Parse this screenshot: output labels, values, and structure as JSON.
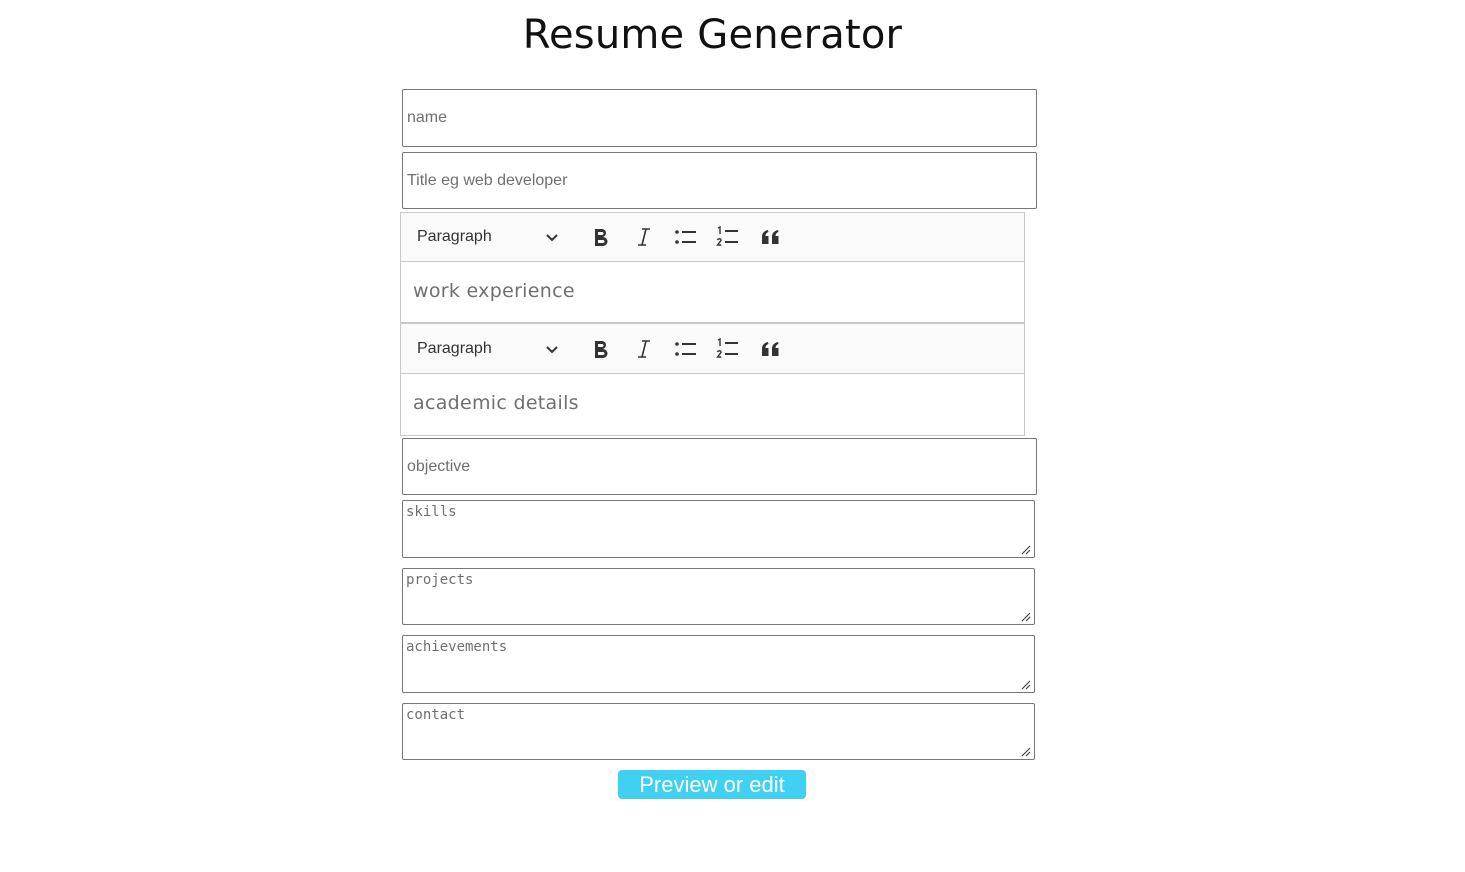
{
  "page": {
    "title": "Resume Generator"
  },
  "form": {
    "name_placeholder": "name",
    "title_placeholder": "Title eg web developer",
    "objective_placeholder": "objective",
    "editors": [
      {
        "heading_value": "Paragraph",
        "placeholder": "work experience"
      },
      {
        "heading_value": "Paragraph",
        "placeholder": "academic details"
      }
    ],
    "textareas": {
      "skills_placeholder": "skills",
      "projects_placeholder": "projects",
      "achievements_placeholder": "achievements",
      "contact_placeholder": "contact"
    },
    "submit_label": "Preview or edit"
  },
  "toolbar_icons": [
    "bold-icon",
    "italic-icon",
    "bulleted-list-icon",
    "numbered-list-icon",
    "block-quote-icon"
  ],
  "colors": {
    "button_bg": "#3fd0f2",
    "button_text": "#ffffff",
    "placeholder": "#6f6f6f"
  }
}
